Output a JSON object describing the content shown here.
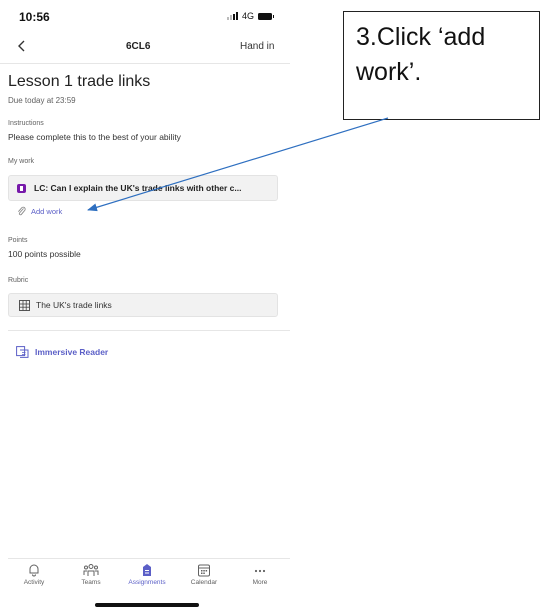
{
  "status_bar": {
    "time": "10:56",
    "network": "4G"
  },
  "nav": {
    "title": "6CL6",
    "hand_in": "Hand in"
  },
  "assignment": {
    "title": "Lesson 1 trade links",
    "due": "Due today at 23:59",
    "instructions_label": "Instructions",
    "instructions_text": "Please complete this to the best of your ability",
    "my_work_label": "My work",
    "work_item": "LC:  Can I explain the UK's trade links with other c...",
    "add_work": "Add work",
    "points_label": "Points",
    "points_text": "100 points possible",
    "rubric_label": "Rubric",
    "rubric_item": "The UK's trade links",
    "immersive_reader": "Immersive Reader"
  },
  "tabs": [
    {
      "label": "Activity",
      "icon": "bell-icon"
    },
    {
      "label": "Teams",
      "icon": "teams-icon"
    },
    {
      "label": "Assignments",
      "icon": "assignments-icon",
      "active": true
    },
    {
      "label": "Calendar",
      "icon": "calendar-icon"
    },
    {
      "label": "More",
      "icon": "more-icon"
    }
  ],
  "callout": {
    "text": "3.Click ‘add work’."
  },
  "colors": {
    "accent": "#5b5fc7",
    "onenote": "#7719aa",
    "arrow": "#2e6fc0"
  }
}
